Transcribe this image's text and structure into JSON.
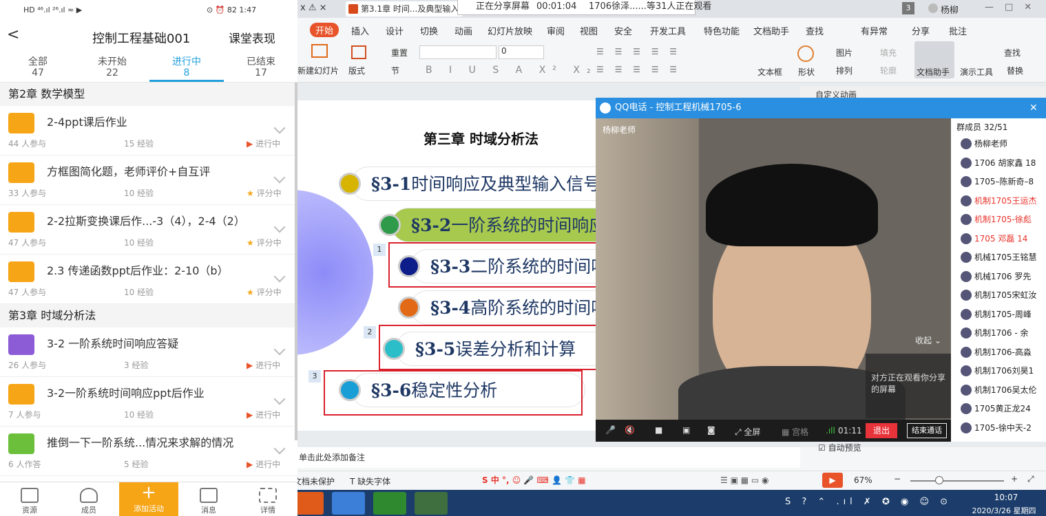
{
  "phone": {
    "status_left": "HD ⁴⁶.ıl ²⁶.ıl ≈ ▶",
    "status_right": "⊙ ⏰ 82 1:47",
    "back": "<",
    "title": "控制工程基础001",
    "action": "课堂表现",
    "tabs": [
      {
        "label": "全部",
        "count": "47"
      },
      {
        "label": "未开始",
        "count": "22"
      },
      {
        "label": "进行中",
        "count": "8"
      },
      {
        "label": "已结束",
        "count": "17"
      }
    ],
    "chapters": [
      "第2章 数学模型",
      "第3章 时域分析法"
    ],
    "items": [
      {
        "title": "2-4ppt课后作业",
        "p": "44 人参与",
        "e": "15 经验",
        "s": "进行中",
        "icon": "#f6a516",
        "st": "play"
      },
      {
        "title": "方框图简化题，老师评价+自互评",
        "p": "33 人参与",
        "e": "10 经验",
        "s": "评分中",
        "icon": "#f6a516",
        "st": "star"
      },
      {
        "title": "2-2拉斯变换课后作...-3（4），2-4（2）",
        "p": "47 人参与",
        "e": "10 经验",
        "s": "评分中",
        "icon": "#f6a516",
        "st": "star"
      },
      {
        "title": "2.3 传递函数ppt后作业：2-10（b）",
        "p": "47 人参与",
        "e": "10 经验",
        "s": "评分中",
        "icon": "#f6a516",
        "st": "star"
      },
      {
        "title": "3-2 一阶系统时间响应答疑",
        "p": "26 人参与",
        "e": "3 经验",
        "s": "进行中",
        "icon": "#8b5cd6",
        "st": "play"
      },
      {
        "title": "3-2一阶系统时间响应ppt后作业",
        "p": "7 人参与",
        "e": "10 经验",
        "s": "进行中",
        "icon": "#f6a516",
        "st": "play"
      },
      {
        "title": "推倒一下一阶系统...情况来求解的情况",
        "p": "6 人作答",
        "e": "5 经验",
        "s": "进行中",
        "icon": "#6bbf3a",
        "st": "play"
      }
    ],
    "nav": [
      "资源",
      "成员",
      "添加活动",
      "消息",
      "详情"
    ]
  },
  "wps": {
    "tab_title": "第3.1章 时间...及典型输入",
    "share_text": "正在分享屏幕",
    "share_time": "00:01:04",
    "watching": "1706徐泽......等31人正在观看",
    "user": "杨柳",
    "badge": "3",
    "menu": [
      "开始",
      "插入",
      "设计",
      "切换",
      "动画",
      "幻灯片放映",
      "审阅",
      "视图",
      "安全",
      "开发工具",
      "特色功能",
      "文档助手",
      "查找",
      "有异常",
      "分享",
      "批注"
    ],
    "ribbon": [
      "新建幻灯片",
      "版式",
      "重置",
      "节",
      "文本框",
      "形状",
      "图片",
      "排列",
      "填充",
      "轮廓",
      "文档助手",
      "演示工具",
      "查找",
      "替换"
    ],
    "font_size": "0",
    "slide": {
      "title": "第三章  时域分析法",
      "sections": [
        {
          "num": "§3-1",
          "text": "时间响应及典型输入信号",
          "color": "#d6b400",
          "bg": "#fff"
        },
        {
          "num": "§3-2",
          "text": "一阶系统的时间响应",
          "color": "#2e9a4a",
          "bg": "#a6c94e"
        },
        {
          "num": "§3-3",
          "text": "二阶系统的时间响应",
          "color": "#0d1d8a",
          "bg": "#fff"
        },
        {
          "num": "§3-4",
          "text": "高阶系统的时间响应",
          "color": "#e26a16",
          "bg": "#fff"
        },
        {
          "num": "§3-5",
          "text": "误差分析和计算",
          "color": "#2bbec8",
          "bg": "#fff"
        },
        {
          "num": "§3-6",
          "text": "稳定性分析",
          "color": "#1a9ed6",
          "bg": "#fff"
        }
      ],
      "labels": [
        "1",
        "2",
        "3"
      ]
    },
    "pane_title": "自定义动画",
    "notes": "单击此处添加备注",
    "autopreview": "自动预览",
    "status": {
      "protect": "文档未保护",
      "font_missing": "缺失字体",
      "zoom": "67%"
    },
    "clock": {
      "time": "10:07",
      "date": "2020/3/26 星期四"
    }
  },
  "qq": {
    "title": "QQ电话 - 控制工程机械1705-6",
    "caller": "杨柳老师",
    "collapse": "收起",
    "tip": "对方正在观看你分享的屏幕",
    "members_header": "群成员 32/51",
    "members": [
      {
        "name": "杨柳老师",
        "red": false
      },
      {
        "name": "1706 胡家鑫 18",
        "red": false
      },
      {
        "name": "1705–陈新奇–8",
        "red": false
      },
      {
        "name": "机制1705王运杰",
        "red": true
      },
      {
        "name": "机制1705-徐彪",
        "red": true
      },
      {
        "name": "1705 邓磊 14",
        "red": true
      },
      {
        "name": "机械1705王铭慧",
        "red": false
      },
      {
        "name": "机械1706 罗先",
        "red": false
      },
      {
        "name": "机制1705宋虹汝",
        "red": false
      },
      {
        "name": "机制1705-周峰",
        "red": false
      },
      {
        "name": "机制1706 - 余",
        "red": false
      },
      {
        "name": "机制1706-高淼",
        "red": false
      },
      {
        "name": "机制1706刘昊1",
        "red": false
      },
      {
        "name": "机制1706吴太伦",
        "red": false
      },
      {
        "name": "1705黄正龙24",
        "red": false
      },
      {
        "name": "1705-徐中天-2",
        "red": false
      }
    ],
    "bar": {
      "fullscreen": "全屏",
      "grid": "宫格",
      "time": "01:11",
      "exit": "退出",
      "end": "结束通话"
    }
  }
}
